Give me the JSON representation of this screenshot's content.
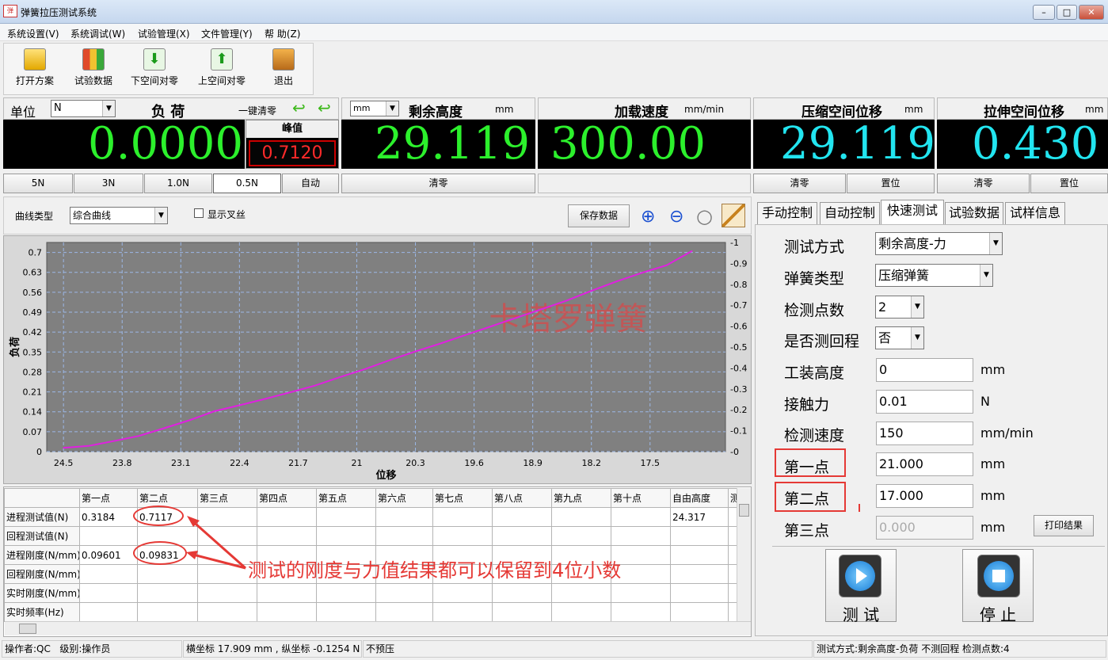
{
  "window": {
    "title": "弹簧拉压测试系统",
    "app_icon": "弹",
    "minimize": "–",
    "maximize": "□",
    "close": "✕"
  },
  "menu": [
    "系统设置(V)",
    "系统调试(W)",
    "试验管理(X)",
    "文件管理(Y)",
    "帮 助(Z)"
  ],
  "toolbar": [
    {
      "label": "打开方案",
      "icon": "folder-icon"
    },
    {
      "label": "试验数据",
      "icon": "data-icon"
    },
    {
      "label": "下空间对零",
      "icon": "down-arrow-icon"
    },
    {
      "label": "上空间对零",
      "icon": "up-arrow-icon"
    },
    {
      "label": "退出",
      "icon": "exit-icon"
    }
  ],
  "load": {
    "unit_label": "单位",
    "unit_value": "N",
    "title": "负  荷",
    "zero_label": "一键清零",
    "value": "0.0000",
    "peak_label": "峰值",
    "peak_value": "0.7120",
    "ranges": [
      "5N",
      "3N",
      "1.0N",
      "0.5N",
      "自动"
    ],
    "selected_range": "0.5N"
  },
  "remaining": {
    "unit_select": "mm",
    "title": "剩余高度",
    "unit": "mm",
    "value": "29.119",
    "clear": "清零"
  },
  "speed": {
    "title": "加载速度",
    "unit": "mm/min",
    "value": "300.00"
  },
  "compress": {
    "title": "压缩空间位移",
    "unit": "mm",
    "value": "29.119",
    "clear": "清零",
    "set": "置位"
  },
  "tension": {
    "title": "拉伸空间位移",
    "unit": "mm",
    "value": "0.430",
    "clear": "清零",
    "set": "置位"
  },
  "chart_controls": {
    "curve_type_label": "曲线类型",
    "curve_type_value": "综合曲线",
    "crosshair_label": "显示叉丝",
    "save_button": "保存数据"
  },
  "chart_data": {
    "type": "line",
    "ylabel": "负荷",
    "xlabel": "位移",
    "watermark": "卡塔罗弹簧",
    "x_ticks": [
      "24.5",
      "23.8",
      "23.1",
      "22.4",
      "21.7",
      "21",
      "20.3",
      "19.6",
      "18.9",
      "18.2",
      "17.5"
    ],
    "y_ticks": [
      "0",
      "0.07",
      "0.14",
      "0.21",
      "0.28",
      "0.35",
      "0.42",
      "0.49",
      "0.56",
      "0.63",
      "0.7"
    ],
    "y2_ticks": [
      "-0",
      "-0.1",
      "-0.2",
      "-0.3",
      "-0.4",
      "-0.5",
      "-0.6",
      "-0.7",
      "-0.8",
      "-0.9",
      "-1"
    ],
    "xlim": [
      24.7,
      16.6
    ],
    "ylim": [
      0,
      0.735
    ],
    "series": [
      {
        "x": [
          24.5,
          24.2,
          23.9,
          23.6,
          23.3,
          23.0,
          22.7,
          22.4,
          22.1,
          21.8,
          21.5,
          21.2,
          20.9,
          20.6,
          20.3,
          20.0,
          19.7,
          19.4,
          19.1,
          18.8,
          18.5,
          18.2,
          17.9,
          17.6,
          17.3,
          17.0
        ],
        "y": [
          0.013,
          0.02,
          0.037,
          0.055,
          0.082,
          0.11,
          0.142,
          0.163,
          0.185,
          0.208,
          0.232,
          0.262,
          0.29,
          0.322,
          0.352,
          0.38,
          0.41,
          0.44,
          0.47,
          0.5,
          0.53,
          0.565,
          0.598,
          0.628,
          0.655,
          0.705
        ]
      }
    ],
    "line_color": "#e020e0"
  },
  "tabs": [
    "手动控制",
    "自动控制",
    "快速测试",
    "试验数据",
    "试样信息"
  ],
  "active_tab": "快速测试",
  "form": {
    "test_mode": {
      "label": "测试方式",
      "value": "剩余高度-力"
    },
    "spring_type": {
      "label": "弹簧类型",
      "value": "压缩弹簧"
    },
    "points": {
      "label": "检测点数",
      "value": "2"
    },
    "return": {
      "label": "是否测回程",
      "value": "否"
    },
    "fixture": {
      "label": "工装高度",
      "value": "0",
      "unit": "mm"
    },
    "contact": {
      "label": "接触力",
      "value": "0.01",
      "unit": "N"
    },
    "speed": {
      "label": "检测速度",
      "value": "150",
      "unit": "mm/min"
    },
    "p1": {
      "label": "第一点",
      "value": "21.000",
      "unit": "mm"
    },
    "p2": {
      "label": "第二点",
      "value": "17.000",
      "unit": "mm"
    },
    "p3": {
      "label": "第三点",
      "value": "0.000",
      "unit": "mm"
    },
    "print": "打印结果",
    "test_btn": "测 试",
    "stop_btn": "停 止"
  },
  "table": {
    "headers": [
      "",
      "第一点",
      "第二点",
      "第三点",
      "第四点",
      "第五点",
      "第六点",
      "第七点",
      "第八点",
      "第九点",
      "第十点",
      "自由高度",
      "测"
    ],
    "rows": [
      [
        "进程测试值(N)",
        "0.3184",
        "0.7117",
        "",
        "",
        "",
        "",
        "",
        "",
        "",
        "",
        "24.317",
        ""
      ],
      [
        "回程测试值(N)",
        "",
        "",
        "",
        "",
        "",
        "",
        "",
        "",
        "",
        "",
        "",
        ""
      ],
      [
        "进程刚度(N/mm)",
        "0.09601",
        "0.09831",
        "",
        "",
        "",
        "",
        "",
        "",
        "",
        "",
        "",
        ""
      ],
      [
        "回程刚度(N/mm)",
        "",
        "",
        "",
        "",
        "",
        "",
        "",
        "",
        "",
        "",
        "",
        ""
      ],
      [
        "实时刚度(N/mm)",
        "",
        "",
        "",
        "",
        "",
        "",
        "",
        "",
        "",
        "",
        "",
        ""
      ],
      [
        "实时频率(Hz)",
        "",
        "",
        "",
        "",
        "",
        "",
        "",
        "",
        "",
        "",
        "",
        ""
      ]
    ]
  },
  "annotation": "测试的刚度与力值结果都可以保留到4位小数",
  "status": {
    "operator": "操作者:QC",
    "level": "级别:操作员",
    "coords": "横坐标 17.909 mm , 纵坐标 -0.1254 N",
    "pre": "不预压",
    "mode": "测试方式:剩余高度-负荷  不测回程  检测点数:4"
  }
}
